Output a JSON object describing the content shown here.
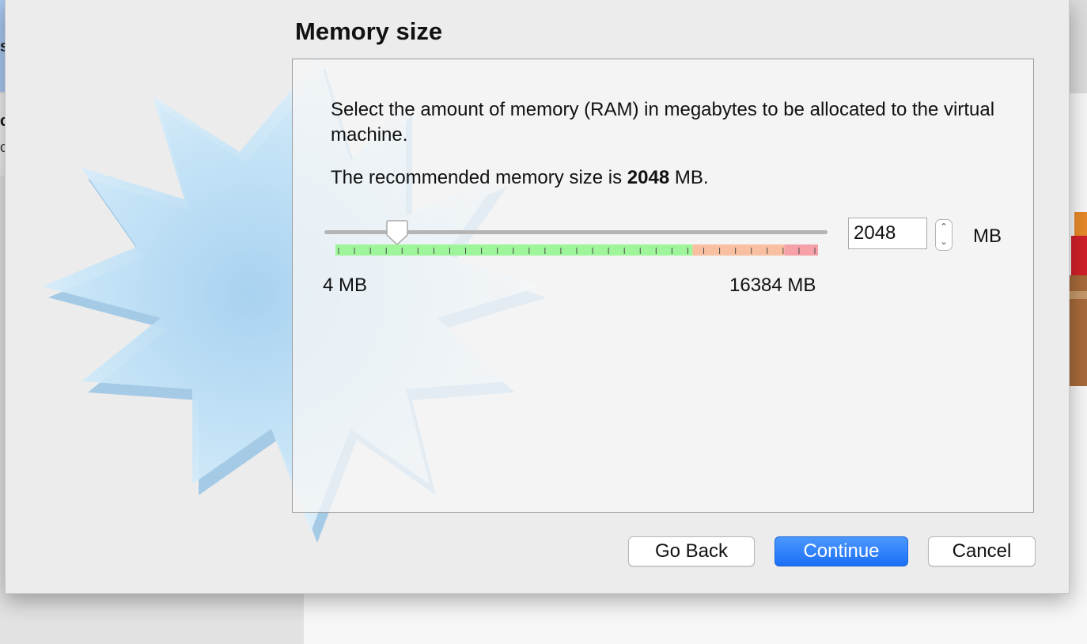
{
  "background": {
    "toolbar_partial_label": "s",
    "sidebar_partial_heading": "c",
    "sidebar_partial_subtext": "o"
  },
  "dialog": {
    "title": "Memory size",
    "description": "Select the amount of memory (RAM) in megabytes to be allocated to the virtual machine.",
    "recommendation_prefix": "The recommended memory size is ",
    "recommendation_value": "2048",
    "recommendation_suffix": " MB.",
    "slider": {
      "min_label": "4 MB",
      "max_label": "16384 MB",
      "min_mb": 4,
      "max_mb": 16384,
      "value_mb": 2048,
      "tick_count": 30
    },
    "memory_input_value": "2048",
    "unit_label": "MB",
    "buttons": {
      "go_back": "Go Back",
      "continue": "Continue",
      "cancel": "Cancel"
    }
  },
  "icons": {
    "watermark": "virtualbox-starburst-icon",
    "stepper_up": "chevron-up-icon",
    "stepper_down": "chevron-down-icon",
    "slider_thumb": "slider-thumb-icon"
  },
  "colors": {
    "primary_button": "#1b6ff6",
    "scale_green": "#9ef59a",
    "scale_orange": "#f8c0a0",
    "scale_red": "#f6a0a8"
  }
}
